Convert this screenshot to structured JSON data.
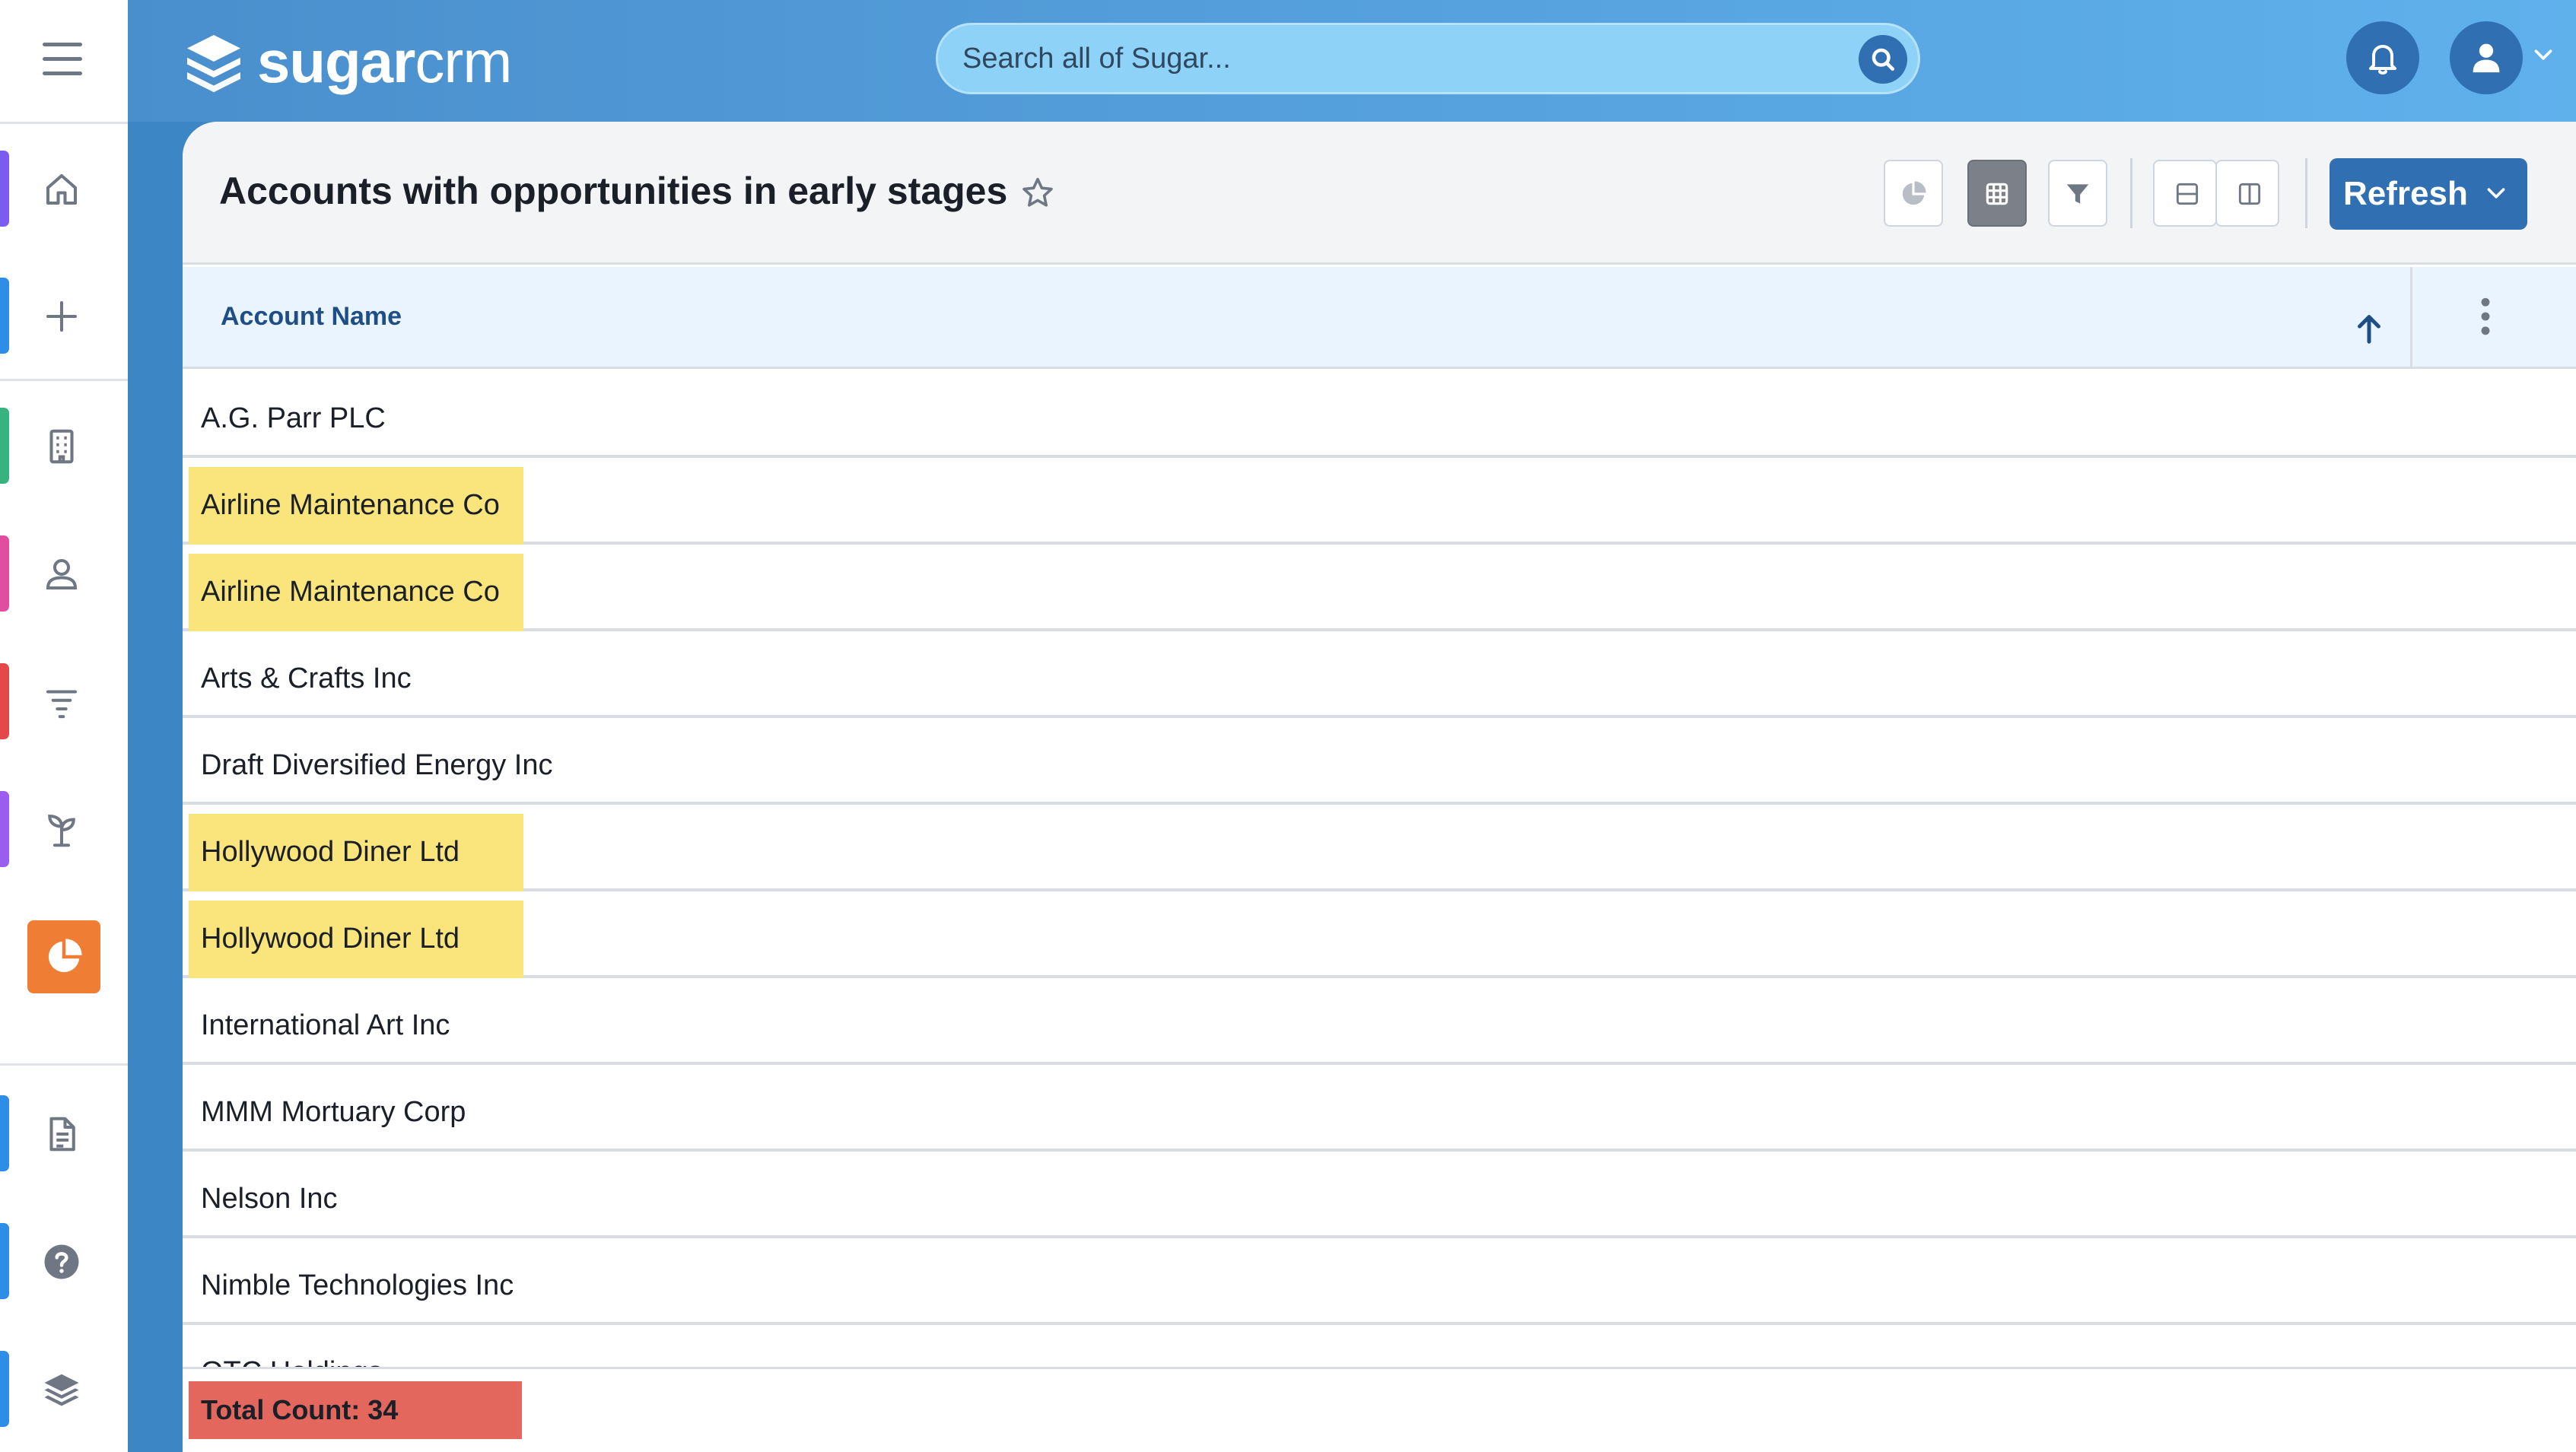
{
  "app": {
    "logo_bold": "sugar",
    "logo_light": "crm"
  },
  "search": {
    "placeholder": "Search all of Sugar..."
  },
  "sidebar": {
    "items": [
      {
        "name": "home",
        "icon": "home-icon",
        "accent": "#7b5cf0"
      },
      {
        "name": "quick-create",
        "icon": "plus-icon",
        "accent": "#2e8de6"
      },
      {
        "name": "accounts",
        "icon": "building-icon",
        "accent": "#36b37e"
      },
      {
        "name": "contacts",
        "icon": "person-icon",
        "accent": "#e14ea0"
      },
      {
        "name": "opportunities",
        "icon": "funnel-icon",
        "accent": "#e54848"
      },
      {
        "name": "leads",
        "icon": "plant-icon",
        "accent": "#9b5cf0"
      },
      {
        "name": "reports",
        "icon": "pie-chart-icon",
        "accent": "#ef7d33",
        "active": true
      },
      {
        "name": "documents",
        "icon": "document-icon",
        "accent": "#2e8de6"
      },
      {
        "name": "help",
        "icon": "help-icon",
        "accent": "#2e8de6"
      },
      {
        "name": "stack",
        "icon": "layers-icon",
        "accent": "#2e8de6"
      }
    ]
  },
  "report": {
    "title": "Accounts with opportunities in early stages",
    "refresh_label": "Refresh"
  },
  "table": {
    "columns": [
      "Account Name"
    ],
    "rows": [
      {
        "name": "A.G. Parr PLC",
        "highlight": false
      },
      {
        "name": "Airline Maintenance Co",
        "highlight": true
      },
      {
        "name": "Airline Maintenance Co",
        "highlight": true
      },
      {
        "name": "Arts & Crafts Inc",
        "highlight": false
      },
      {
        "name": "Draft Diversified Energy Inc",
        "highlight": false
      },
      {
        "name": "Hollywood Diner Ltd",
        "highlight": true
      },
      {
        "name": "Hollywood Diner Ltd",
        "highlight": true
      },
      {
        "name": "International Art Inc",
        "highlight": false
      },
      {
        "name": "MMM Mortuary Corp",
        "highlight": false
      },
      {
        "name": "Nelson Inc",
        "highlight": false
      },
      {
        "name": "Nimble Technologies Inc",
        "highlight": false
      },
      {
        "name": "OTC Holdings",
        "highlight": false
      }
    ],
    "total_count": "Total Count: 34"
  },
  "colors": {
    "brand_blue": "#2f6fb2",
    "highlight_yellow": "#f9e57c",
    "total_red": "#e4675e",
    "header_bg": "#e9f4fe"
  }
}
